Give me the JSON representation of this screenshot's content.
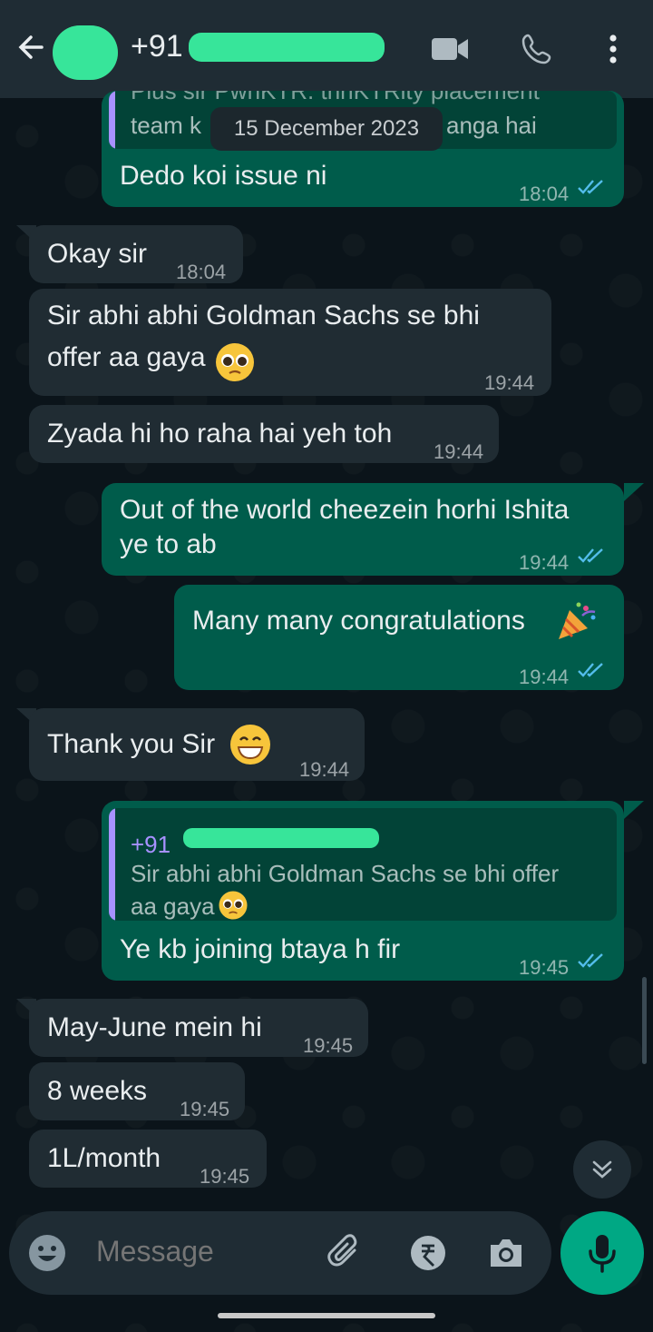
{
  "header": {
    "contact_prefix": "+91",
    "icons": [
      "back-arrow-icon",
      "video-call-icon",
      "voice-call-icon",
      "more-options-icon"
    ]
  },
  "date_chip": "15 December 2023",
  "messages": {
    "m0": {
      "quoted_text_line1": "Plus sir PwhKTR. thhKTRity placement",
      "quoted_text_line2": "team k",
      "quoted_text_line2_tail": "anga hai",
      "text": "Dedo koi issue ni",
      "time": "18:04"
    },
    "m1": {
      "text": "Okay sir",
      "time": "18:04"
    },
    "m2": {
      "text_line1": "Sir abhi abhi Goldman Sachs se bhi",
      "text_line2": "offer aa gaya",
      "emoji": "pleading-face",
      "time": "19:44"
    },
    "m3": {
      "text": "Zyada hi ho raha hai yeh toh",
      "time": "19:44"
    },
    "m4": {
      "text_line1": "Out of the world cheezein horhi Ishita",
      "text_line2": "ye to ab",
      "time": "19:44"
    },
    "m5": {
      "text": "Many many congratulations",
      "emoji": "party-popper",
      "time": "19:44"
    },
    "m6": {
      "text": "Thank you Sir",
      "emoji": "grinning-face",
      "time": "19:44"
    },
    "m7": {
      "quoted_name": "+91",
      "quoted_text_line1": "Sir abhi abhi Goldman Sachs se bhi offer",
      "quoted_text_line2": "aa gaya",
      "text": "Ye kb joining btaya h fir",
      "time": "19:45"
    },
    "m8": {
      "text": "May-June mein hi",
      "time": "19:45"
    },
    "m9": {
      "text": "8 weeks",
      "time": "19:45"
    },
    "m10": {
      "text": "1L/month",
      "time": "19:45"
    }
  },
  "input": {
    "placeholder": "Message",
    "icons": [
      "emoji-icon",
      "attach-icon",
      "rupee-payment-icon",
      "camera-icon",
      "mic-icon"
    ]
  },
  "colors": {
    "header_bg": "#1f2c34",
    "chat_bg": "#0b141a",
    "incoming_bubble": "#202c33",
    "outgoing_bubble": "#005c4b",
    "read_ticks": "#53bdeb",
    "accent": "#00a884"
  }
}
